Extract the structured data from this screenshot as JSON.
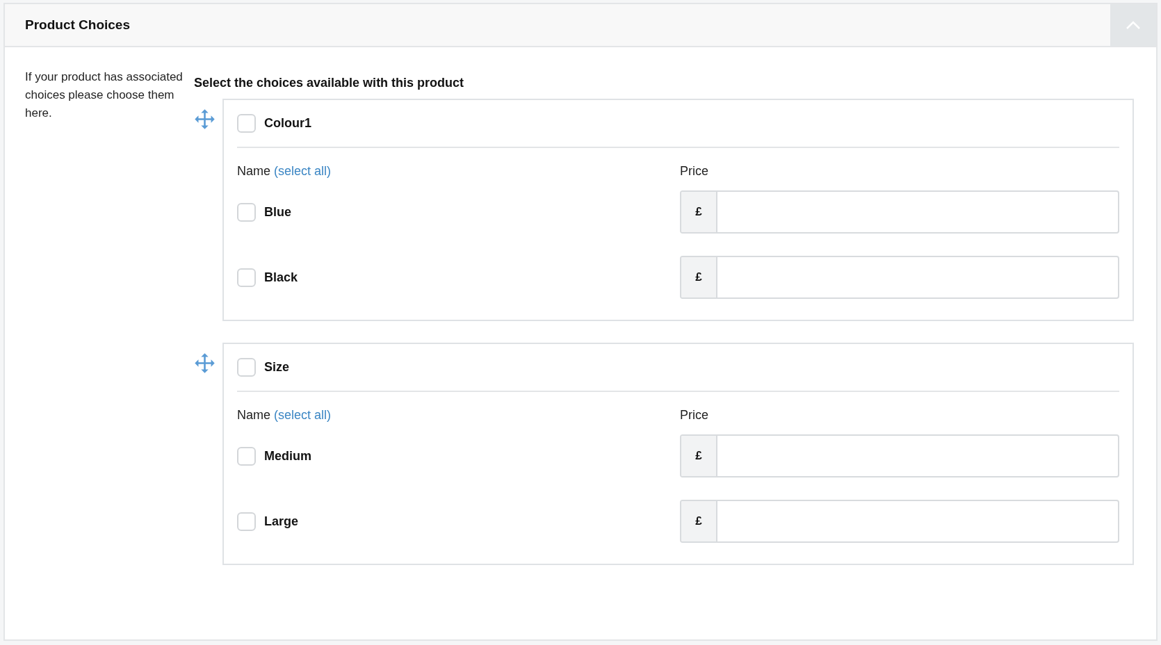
{
  "panel": {
    "title": "Product Choices",
    "expanded": true
  },
  "help_text": "If your product has associated choices please choose them here.",
  "heading": "Select the choices available with this product",
  "groups": [
    {
      "name": "Colour1",
      "checked": false,
      "name_label": "Name",
      "select_all": "(select all)",
      "price_label": "Price",
      "options": [
        {
          "name": "Blue",
          "checked": false,
          "currency": "£"
        },
        {
          "name": "Black",
          "checked": false,
          "currency": "£"
        }
      ]
    },
    {
      "name": "Size",
      "checked": false,
      "name_label": "Name",
      "select_all": "(select all)",
      "price_label": "Price",
      "options": [
        {
          "name": "Medium",
          "checked": false,
          "currency": "£"
        },
        {
          "name": "Large",
          "checked": false,
          "currency": "£"
        }
      ]
    }
  ]
}
